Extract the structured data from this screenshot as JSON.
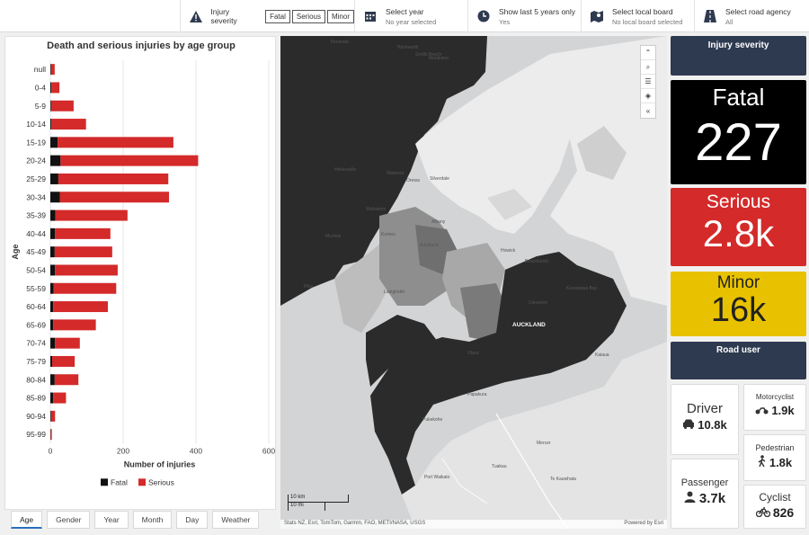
{
  "topbar": {
    "severity_label": "Injury severity",
    "severity_buttons": [
      "Fatal",
      "Serious",
      "Minor"
    ],
    "year": {
      "label": "Select year",
      "value": "No year selected"
    },
    "last5": {
      "label": "Show last 5 years only",
      "value": "Yes"
    },
    "board": {
      "label": "Select local board",
      "value": "No local board selected"
    },
    "agency": {
      "label": "Select road agency",
      "value": "All"
    }
  },
  "chart_data": {
    "type": "bar",
    "orientation": "horizontal",
    "stacked": true,
    "title": "Death and serious injuries by age group",
    "xlabel": "Number of injuries",
    "ylabel": "Age",
    "xlim": [
      0,
      600
    ],
    "xticks": [
      0,
      200,
      400,
      600
    ],
    "categories": [
      "null",
      "0-4",
      "5-9",
      "10-14",
      "15-19",
      "20-24",
      "25-29",
      "30-34",
      "35-39",
      "40-44",
      "45-49",
      "50-54",
      "55-59",
      "60-64",
      "65-69",
      "70-74",
      "75-79",
      "80-84",
      "85-89",
      "90-94",
      "95-99"
    ],
    "series": [
      {
        "name": "Fatal",
        "color": "#111111",
        "values": [
          2,
          3,
          2,
          3,
          20,
          28,
          22,
          26,
          14,
          13,
          12,
          13,
          9,
          8,
          8,
          13,
          5,
          12,
          8,
          2,
          1
        ]
      },
      {
        "name": "Serious",
        "color": "#d42a2a",
        "values": [
          10,
          22,
          62,
          95,
          318,
          378,
          302,
          300,
          198,
          152,
          158,
          172,
          172,
          150,
          117,
          68,
          62,
          65,
          35,
          11,
          3
        ]
      }
    ],
    "legend": "bottom"
  },
  "tabs": [
    "Age",
    "Gender",
    "Year",
    "Month",
    "Day",
    "Weather"
  ],
  "map": {
    "attribution": "Stats NZ, Esri, TomTom, Garmin, FAO, METI/NASA, USGS",
    "powered": "Powered by Esri",
    "scale_km": "10 km",
    "scale_mi": "10 mi",
    "labels": [
      "Tomarata",
      "Warkworth",
      "Snells Beach",
      "Matakana",
      "Helensville",
      "Waiwera",
      "Orewa",
      "Silverdale",
      "Muriwai",
      "Albany",
      "Kumeu",
      "Waitakere",
      "Auckland",
      "Piha",
      "Laingholm",
      "Howick",
      "Beachlands",
      "Clevedon",
      "AUCKLAND",
      "Otara",
      "Papakura",
      "Kawakawa Bay",
      "Kaiaua",
      "Pukekohe",
      "Tuakau",
      "Mercer",
      "Port Waikato",
      "Te Kauwhata"
    ]
  },
  "right": {
    "severity_header": "Injury severity",
    "fatal": {
      "label": "Fatal",
      "value": "227"
    },
    "serious": {
      "label": "Serious",
      "value": "2.8k"
    },
    "minor": {
      "label": "Minor",
      "value": "16k"
    },
    "road_user_header": "Road user",
    "driver": {
      "label": "Driver",
      "value": "10.8k"
    },
    "motorcyclist": {
      "label": "Motorcyclist",
      "value": "1.9k"
    },
    "pedestrian": {
      "label": "Pedestrian",
      "value": "1.8k"
    },
    "passenger": {
      "label": "Passenger",
      "value": "3.7k"
    },
    "cyclist": {
      "label": "Cyclist",
      "value": "826"
    }
  },
  "colors": {
    "fatal_bg": "#000000",
    "serious_bg": "#d42a2a",
    "minor_bg": "#e8c200",
    "header_bg": "#2e3a4f"
  }
}
